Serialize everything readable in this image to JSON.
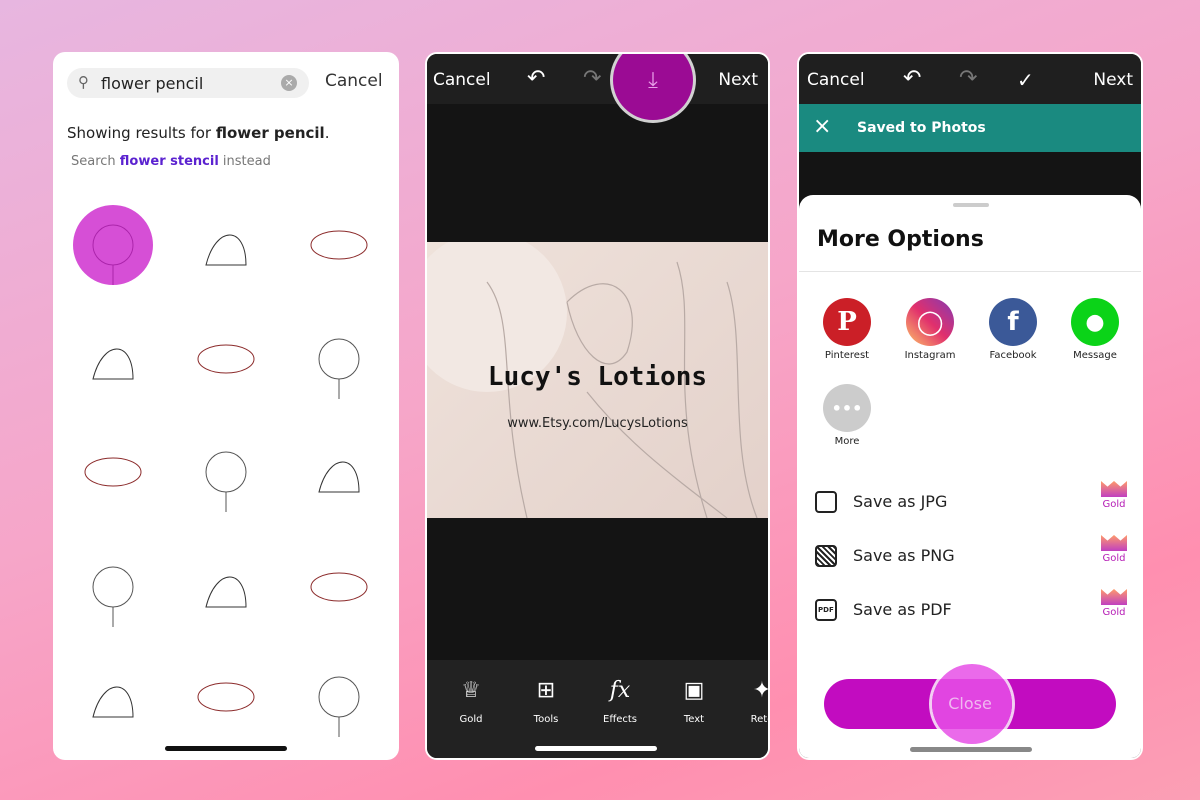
{
  "search_panel": {
    "query": "flower pencil",
    "cancel": "Cancel",
    "results_prefix": "Showing results for ",
    "results_query": "flower pencil",
    "results_suffix": ".",
    "suggest_prefix": "Search ",
    "suggest_term": "flower stencil",
    "suggest_suffix": " instead"
  },
  "editor": {
    "cancel": "Cancel",
    "next": "Next",
    "icons": [
      "undo-icon",
      "redo-icon",
      "download-icon"
    ],
    "canvas_title": "Lucy's Lotions",
    "canvas_url": "www.Etsy.com/LucysLotions",
    "tools": [
      {
        "label": "Gold",
        "icon": "crown-icon"
      },
      {
        "label": "Tools",
        "icon": "crop-icon"
      },
      {
        "label": "Effects",
        "icon": "fx-icon"
      },
      {
        "label": "Text",
        "icon": "text-icon"
      },
      {
        "label": "Reto",
        "icon": "retouch-icon"
      }
    ]
  },
  "share": {
    "cancel": "Cancel",
    "next": "Next",
    "banner": "Saved to Photos",
    "title": "More Options",
    "apps": [
      {
        "label": "Pinterest",
        "color": "#cb1f27"
      },
      {
        "label": "Instagram",
        "color": "#d6249f"
      },
      {
        "label": "Facebook",
        "color": "#3b5998"
      },
      {
        "label": "Message",
        "color": "#0bd318"
      },
      {
        "label": "More",
        "color": "#cccccc"
      }
    ],
    "saves": [
      {
        "label": "Save as JPG",
        "badge": "Gold"
      },
      {
        "label": "Save as PNG",
        "badge": "Gold"
      },
      {
        "label": "Save as PDF",
        "badge": "Gold"
      }
    ],
    "close": "Close",
    "accent": "#c20cc0",
    "banner_color": "#1a8a80"
  }
}
